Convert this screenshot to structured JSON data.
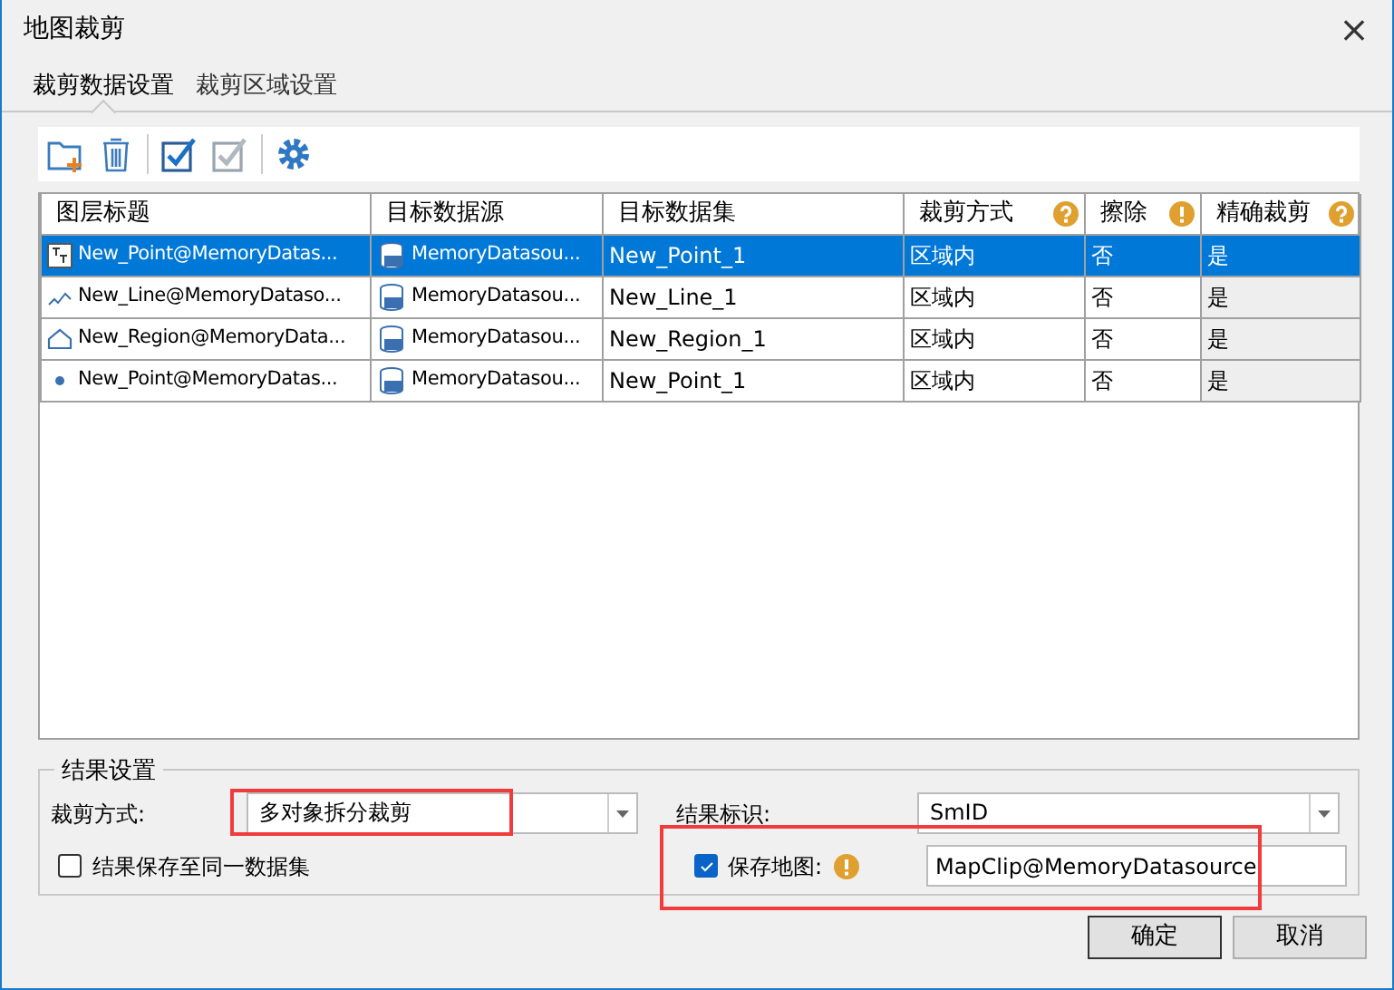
{
  "window": {
    "title": "地图裁剪",
    "close": "×"
  },
  "tabs": [
    {
      "label": "裁剪数据设置",
      "selected": true
    },
    {
      "label": "裁剪区域设置",
      "selected": false
    }
  ],
  "toolbar": [
    {
      "kind": "add"
    },
    {
      "kind": "delete"
    },
    {
      "kind": "select-all"
    },
    {
      "kind": "invert"
    },
    {
      "kind": "settings"
    }
  ],
  "table": {
    "columns": [
      {
        "label": "图层标题"
      },
      {
        "label": "目标数据源"
      },
      {
        "label": "目标数据集"
      },
      {
        "label": "裁剪方式",
        "kind": "help"
      },
      {
        "label": "擦除",
        "kind": "warning"
      },
      {
        "label": "精确裁剪",
        "kind": "help"
      }
    ],
    "rows": [
      {
        "kind": "text",
        "selected": true,
        "layer": "New_Point@MemoryDatas...",
        "datasource": "MemoryDatasou...",
        "dataset": "New_Point_1",
        "mode": "区域内",
        "erase": "否",
        "exact": "是"
      },
      {
        "kind": "line",
        "selected": false,
        "layer": "New_Line@MemoryDataso...",
        "datasource": "MemoryDatasou...",
        "dataset": "New_Line_1",
        "mode": "区域内",
        "erase": "否",
        "exact": "是"
      },
      {
        "kind": "region",
        "selected": false,
        "layer": "New_Region@MemoryData...",
        "datasource": "MemoryDatasou...",
        "dataset": "New_Region_1",
        "mode": "区域内",
        "erase": "否",
        "exact": "是"
      },
      {
        "kind": "point",
        "selected": false,
        "layer": "New_Point@MemoryDatas...",
        "datasource": "MemoryDatasou...",
        "dataset": "New_Point_1",
        "mode": "区域内",
        "erase": "否",
        "exact": "是"
      }
    ]
  },
  "result": {
    "legend": "结果设置",
    "clip_mode": {
      "label": "裁剪方式:",
      "value": "多对象拆分裁剪",
      "highlighted": true
    },
    "result_field": {
      "label": "结果标识:",
      "value": "SmID"
    },
    "same_dataset": {
      "label": "结果保存至同一数据集",
      "checked": false
    },
    "save_map": {
      "label": "保存地图:",
      "checked": true,
      "value": "MapClip@MemoryDatasource",
      "highlighted": true
    }
  },
  "buttons": [
    {
      "label": "确定",
      "default": true
    },
    {
      "label": "取消",
      "default": false
    }
  ]
}
